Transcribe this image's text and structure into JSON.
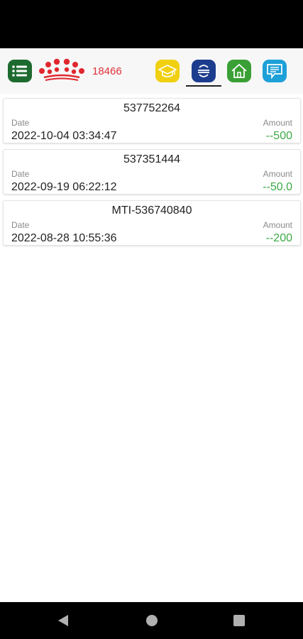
{
  "toolbar": {
    "points": "18466",
    "icons": [
      "list-menu-icon",
      "crown-logo",
      "graduation-cap-icon",
      "exchange-icon",
      "home-icon",
      "message-icon"
    ],
    "colors": {
      "menu": "#1d6a30",
      "edu": "#f0d010",
      "exchange": "#1c3d8e",
      "home": "#3aa035",
      "message": "#1ea0d8",
      "points": "#e0323a"
    }
  },
  "transactions": [
    {
      "id": "537752264",
      "date_label": "Date",
      "amount_label": "Amount",
      "date": "2022-10-04 03:34:47",
      "amount": "--500"
    },
    {
      "id": "537351444",
      "date_label": "Date",
      "amount_label": "Amount",
      "date": "2022-09-19 06:22:12",
      "amount": "--50.0"
    },
    {
      "id": "MTI-536740840",
      "date_label": "Date",
      "amount_label": "Amount",
      "date": "2022-08-28 10:55:36",
      "amount": "--200"
    }
  ],
  "colors": {
    "amount": "#3ca844"
  }
}
